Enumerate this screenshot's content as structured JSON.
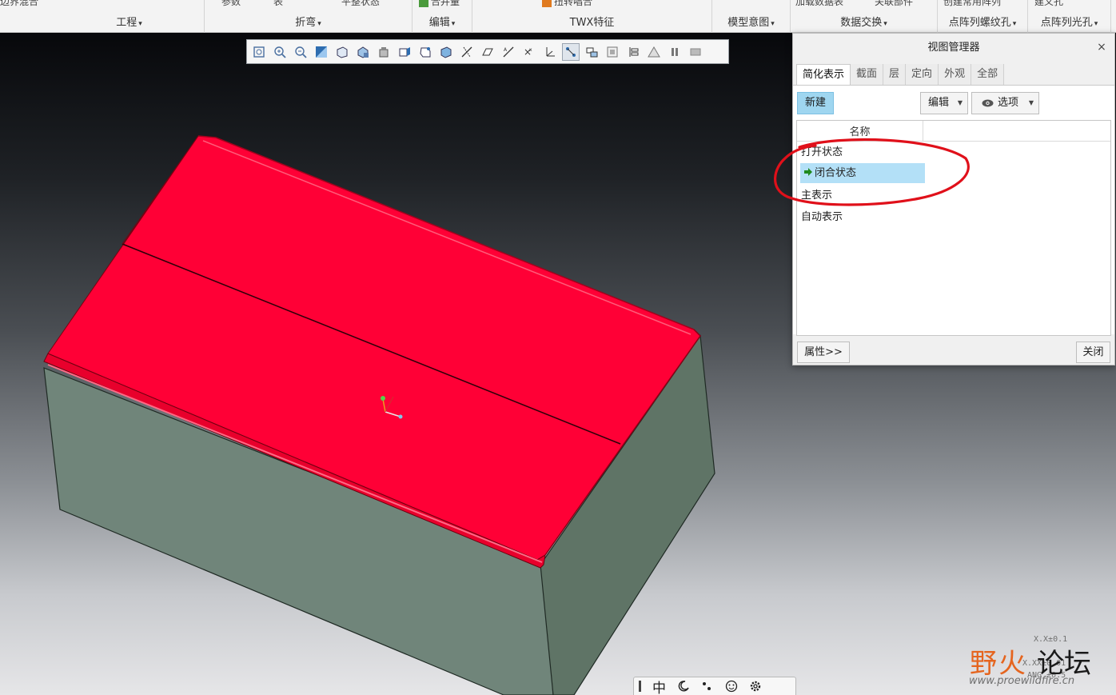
{
  "ribbon": {
    "groups": [
      {
        "label": "工程"
      },
      {
        "label": "折弯"
      },
      {
        "label": "编辑"
      },
      {
        "label": "TWX特征"
      },
      {
        "label": "模型意图"
      },
      {
        "label": "数据交换"
      },
      {
        "label": "点阵列螺纹孔"
      },
      {
        "label": "点阵列光孔"
      }
    ],
    "caret": "▾",
    "cut_top_items": [
      "边界混合",
      "参数",
      "表",
      "平整状态",
      "合并量",
      "扭转唱合",
      "加载数据表",
      "关联部件",
      "创建常用阵列",
      "建义孔"
    ]
  },
  "graphics_toolbar": {
    "icons": [
      "refit-icon",
      "zoom-in-icon",
      "zoom-out-icon",
      "repaint-icon",
      "saved-orientations-icon",
      "view-manager-icon",
      "perspective-icon",
      "spin-center-icon",
      "datum-display-icon",
      "shading-icon",
      "datum-planes-icon",
      "datum-axes-icon",
      "datum-points-icon",
      "point-tags-icon",
      "csys-icon",
      "annotation-display-icon",
      "display-style-icon",
      "model-tree-filter-icon",
      "layers-icon",
      "warning-icon",
      "pause-icon",
      "close-view-icon"
    ],
    "active_index": 15
  },
  "view_manager": {
    "title": "视图管理器",
    "close_glyph": "×",
    "tabs": [
      "简化表示",
      "截面",
      "层",
      "定向",
      "外观",
      "全部"
    ],
    "active_tab": 0,
    "new_button": "新建",
    "edit_button": "编辑",
    "options_button": "选项",
    "column_name": "名称",
    "rows": [
      {
        "label": "打开状态",
        "selected": false
      },
      {
        "label": "闭合状态",
        "selected": true
      },
      {
        "label": "主表示",
        "selected": false
      },
      {
        "label": "自动表示",
        "selected": false
      }
    ],
    "properties_button": "属性>>",
    "close_button": "关闭"
  },
  "ime_bar": {
    "mode": "中"
  },
  "watermark": {
    "logo_orange": "野火",
    "logo_black": "论坛",
    "url": "www.proewildfire.cn",
    "tolerances": [
      "X.X±0.1",
      "X.XX±0.01",
      "ANG ±0.5"
    ]
  },
  "colors": {
    "model_top": "#ff0036",
    "model_side": "#6e8474",
    "selection": "#b3e0f7",
    "new_button": "#9fd6f0",
    "annotation": "#e0101a"
  }
}
